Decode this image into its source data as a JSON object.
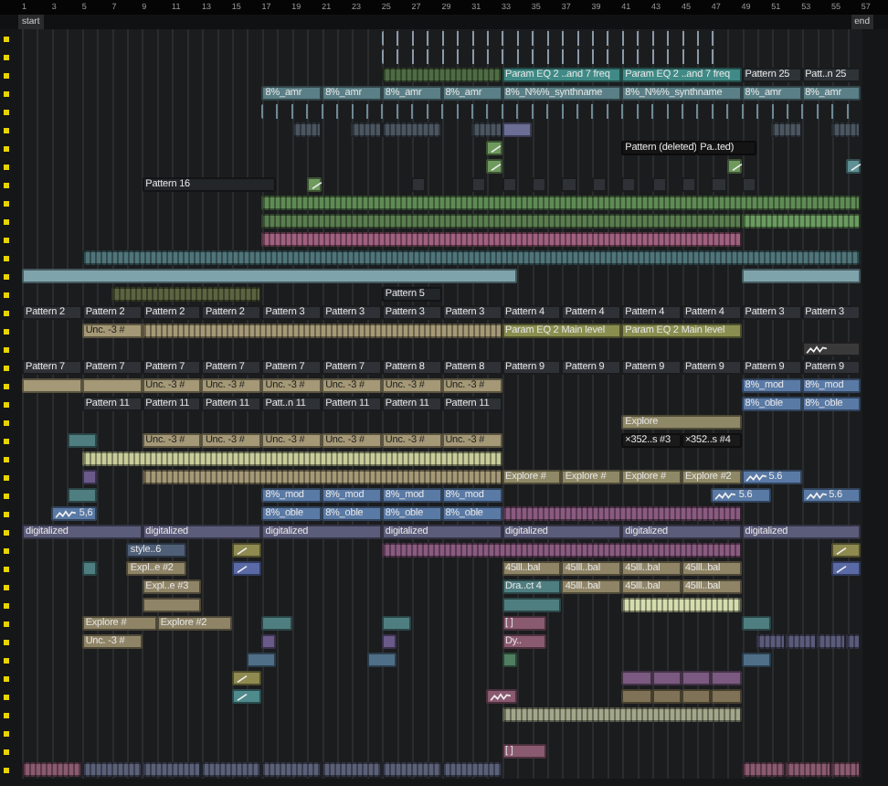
{
  "ruler": [
    "1",
    "3",
    "5",
    "7",
    "9",
    "11",
    "13",
    "15",
    "17",
    "19",
    "21",
    "23",
    "25",
    "27",
    "29",
    "31",
    "33",
    "35",
    "37",
    "39",
    "41",
    "43",
    "45",
    "47",
    "49",
    "51",
    "53",
    "55",
    "57"
  ],
  "markers": {
    "start": "start",
    "end": "end"
  },
  "tracks": [
    {
      "clips": [
        {
          "kind": "ticks",
          "color": "#8a9aa8"
        }
      ]
    },
    {
      "clips": [
        {
          "kind": "ticks",
          "color": "#8a9aa8"
        }
      ]
    },
    {
      "clips": [
        {
          "kind": "stripes",
          "color": "#4f6b45"
        },
        {
          "kind": "clip",
          "color": "#3f8a86",
          "label": "Param EQ 2 ..and 7 freq"
        },
        {
          "kind": "clip",
          "color": "#3f8a86",
          "label": "Param EQ 2 ..and 7 freq"
        },
        {
          "kind": "clip",
          "color": "#2e3338",
          "label": "Pattern 25"
        },
        {
          "kind": "clip",
          "color": "#2e3338",
          "label": "Patt..n 25"
        }
      ]
    },
    {
      "clips": [
        {
          "kind": "clip",
          "color": "#5a7f86",
          "label": "8%_amr"
        },
        {
          "kind": "clip",
          "color": "#5a7f86",
          "label": "8%_amr"
        },
        {
          "kind": "clip",
          "color": "#5a7f86",
          "label": "8%_amr"
        },
        {
          "kind": "clip",
          "color": "#5a7f86",
          "label": "8%_amr"
        },
        {
          "kind": "clip",
          "color": "#5a7f86",
          "label": "8%_N%%_synthname"
        },
        {
          "kind": "clip",
          "color": "#5a7f86",
          "label": "8%_N%%_synthname"
        },
        {
          "kind": "clip",
          "color": "#5a7f86",
          "label": "8%_amr"
        },
        {
          "kind": "clip",
          "color": "#5a7f86",
          "label": "8%_amr"
        }
      ]
    },
    {
      "clips": [
        {
          "kind": "ticks",
          "color": "#6d8894"
        }
      ]
    },
    {
      "clips": [
        {
          "kind": "stripes",
          "color": "#4a5560"
        },
        {
          "kind": "stripes",
          "color": "#4a5560"
        },
        {
          "kind": "stripes",
          "color": "#4a5560"
        },
        {
          "kind": "stripes",
          "color": "#4a5560"
        },
        {
          "kind": "clip",
          "color": "#6c6e96"
        },
        {
          "kind": "stripes",
          "color": "#4a5560"
        },
        {
          "kind": "stripes",
          "color": "#4a5560"
        }
      ]
    },
    {
      "clips": [
        {
          "kind": "curve",
          "color": "#6f9a5e"
        },
        {
          "kind": "clip",
          "color": "#141414",
          "label": "Pattern (deleted)"
        },
        {
          "kind": "clip",
          "color": "#141414",
          "label": "Pa..ted)"
        }
      ]
    },
    {
      "clips": [
        {
          "kind": "curve",
          "color": "#6f9a5e"
        },
        {
          "kind": "curve",
          "color": "#6f9a5e"
        },
        {
          "kind": "curve",
          "color": "#5f9096"
        }
      ]
    },
    {
      "clips": [
        {
          "kind": "clip",
          "color": "#232629",
          "label": "Pattern 16"
        },
        {
          "kind": "curve",
          "color": "#6f9a5e"
        },
        {
          "kind": "clip",
          "color": "#2e3236"
        },
        {
          "kind": "clip",
          "color": "#2e3236"
        },
        {
          "kind": "clip",
          "color": "#2e3236"
        },
        {
          "kind": "clip",
          "color": "#2e3236"
        },
        {
          "kind": "clip",
          "color": "#2e3236"
        },
        {
          "kind": "clip",
          "color": "#2e3236"
        },
        {
          "kind": "clip",
          "color": "#2e3236"
        },
        {
          "kind": "clip",
          "color": "#2e3236"
        },
        {
          "kind": "clip",
          "color": "#2e3236"
        },
        {
          "kind": "clip",
          "color": "#2e3236"
        },
        {
          "kind": "clip",
          "color": "#2e3236"
        }
      ]
    },
    {
      "clips": [
        {
          "kind": "stripes",
          "color": "#5f8a55"
        }
      ]
    },
    {
      "clips": [
        {
          "kind": "stripes",
          "color": "#5a7d50"
        },
        {
          "kind": "stripes",
          "color": "#6a9a60"
        }
      ]
    },
    {
      "clips": [
        {
          "kind": "stripes",
          "color": "#a0607f"
        }
      ]
    },
    {
      "clips": [
        {
          "kind": "stripes",
          "color": "#4f7479"
        }
      ]
    },
    {
      "clips": [
        {
          "kind": "clip",
          "color": "#7fa3ab"
        },
        {
          "kind": "clip",
          "color": "#7fa3ab"
        }
      ]
    },
    {
      "clips": [
        {
          "kind": "stripes",
          "color": "#5b6340"
        },
        {
          "kind": "clip",
          "color": "#232629",
          "label": "Pattern 5"
        }
      ]
    },
    {
      "clips": [
        {
          "kind": "clip",
          "color": "#2e3236",
          "label": "Pattern 2"
        },
        {
          "kind": "clip",
          "color": "#2e3236",
          "label": "Pattern 2"
        },
        {
          "kind": "clip",
          "color": "#2e3236",
          "label": "Pattern 2"
        },
        {
          "kind": "clip",
          "color": "#2e3236",
          "label": "Pattern 2"
        },
        {
          "kind": "clip",
          "color": "#2e3236",
          "label": "Pattern 3"
        },
        {
          "kind": "clip",
          "color": "#2e3236",
          "label": "Pattern 3"
        },
        {
          "kind": "clip",
          "color": "#2e3236",
          "label": "Pattern 3"
        },
        {
          "kind": "clip",
          "color": "#2e3236",
          "label": "Pattern 3"
        },
        {
          "kind": "clip",
          "color": "#2e3236",
          "label": "Pattern 4"
        },
        {
          "kind": "clip",
          "color": "#2e3236",
          "label": "Pattern 4"
        },
        {
          "kind": "clip",
          "color": "#2e3236",
          "label": "Pattern 4"
        },
        {
          "kind": "clip",
          "color": "#2e3236",
          "label": "Pattern 4"
        },
        {
          "kind": "clip",
          "color": "#2e3236",
          "label": "Pattern 3"
        },
        {
          "kind": "clip",
          "color": "#2e3236",
          "label": "Pattern 3"
        }
      ]
    },
    {
      "clips": [
        {
          "kind": "clip",
          "color": "#a49876",
          "label": "Unc. -3 #"
        },
        {
          "kind": "stripes",
          "color": "#a49876"
        },
        {
          "kind": "clip",
          "color": "#8a8f50",
          "label": "Param EQ 2 Main level"
        },
        {
          "kind": "clip",
          "color": "#8a8f50",
          "label": "Param EQ 2 Main level"
        }
      ]
    },
    {
      "clips": [
        {
          "kind": "squiggle",
          "color": "#3a3a3a"
        }
      ]
    },
    {
      "clips": [
        {
          "kind": "clip",
          "color": "#2e3236",
          "label": "Pattern 7"
        },
        {
          "kind": "clip",
          "color": "#2e3236",
          "label": "Pattern 7"
        },
        {
          "kind": "clip",
          "color": "#2e3236",
          "label": "Pattern 7"
        },
        {
          "kind": "clip",
          "color": "#2e3236",
          "label": "Pattern 7"
        },
        {
          "kind": "clip",
          "color": "#2e3236",
          "label": "Pattern 7"
        },
        {
          "kind": "clip",
          "color": "#2e3236",
          "label": "Pattern 7"
        },
        {
          "kind": "clip",
          "color": "#2e3236",
          "label": "Pattern 8"
        },
        {
          "kind": "clip",
          "color": "#2e3236",
          "label": "Pattern 8"
        },
        {
          "kind": "clip",
          "color": "#2e3236",
          "label": "Pattern 9"
        },
        {
          "kind": "clip",
          "color": "#2e3236",
          "label": "Pattern 9"
        },
        {
          "kind": "clip",
          "color": "#2e3236",
          "label": "Pattern 9"
        },
        {
          "kind": "clip",
          "color": "#2e3236",
          "label": "Pattern 9"
        },
        {
          "kind": "clip",
          "color": "#2e3236",
          "label": "Pattern 9"
        },
        {
          "kind": "clip",
          "color": "#2e3236",
          "label": "Pattern 9"
        }
      ]
    },
    {
      "clips": [
        {
          "kind": "clip",
          "color": "#a49876"
        },
        {
          "kind": "clip",
          "color": "#a49876"
        },
        {
          "kind": "clip",
          "color": "#a49876",
          "label": "Unc. -3 #"
        },
        {
          "kind": "clip",
          "color": "#a49876",
          "label": "Unc. -3 #"
        },
        {
          "kind": "clip",
          "color": "#a49876",
          "label": "Unc. -3 #"
        },
        {
          "kind": "clip",
          "color": "#a49876",
          "label": "Unc. -3 #"
        },
        {
          "kind": "clip",
          "color": "#a49876",
          "label": "Unc. -3 #"
        },
        {
          "kind": "clip",
          "color": "#a49876",
          "label": "Unc. -3 #"
        },
        {
          "kind": "clip",
          "color": "#5a7aa6",
          "label": "8%_mod"
        },
        {
          "kind": "clip",
          "color": "#5a7aa6",
          "label": "8%_mod"
        }
      ]
    },
    {
      "clips": [
        {
          "kind": "clip",
          "color": "#2e3236",
          "label": "Pattern 11"
        },
        {
          "kind": "clip",
          "color": "#2e3236",
          "label": "Pattern 11"
        },
        {
          "kind": "clip",
          "color": "#2e3236",
          "label": "Pattern 11"
        },
        {
          "kind": "clip",
          "color": "#2e3236",
          "label": "Patt..n 11"
        },
        {
          "kind": "clip",
          "color": "#2e3236",
          "label": "Pattern 11"
        },
        {
          "kind": "clip",
          "color": "#2e3236",
          "label": "Pattern 11"
        },
        {
          "kind": "clip",
          "color": "#2e3236",
          "label": "Pattern 11"
        },
        {
          "kind": "clip",
          "color": "#5a7aa6",
          "label": "8%_oble"
        },
        {
          "kind": "clip",
          "color": "#5a7aa6",
          "label": "8%_oble"
        }
      ]
    },
    {
      "clips": [
        {
          "kind": "clip",
          "color": "#8f8866",
          "label": "Explore"
        }
      ]
    },
    {
      "clips": [
        {
          "kind": "clip",
          "color": "#4f7e80"
        },
        {
          "kind": "clip",
          "color": "#a49876",
          "label": "Unc. -3 #"
        },
        {
          "kind": "clip",
          "color": "#a49876",
          "label": "Unc. -3 #"
        },
        {
          "kind": "clip",
          "color": "#a49876",
          "label": "Unc. -3 #"
        },
        {
          "kind": "clip",
          "color": "#a49876",
          "label": "Unc. -3 #"
        },
        {
          "kind": "clip",
          "color": "#a49876",
          "label": "Unc. -3 #"
        },
        {
          "kind": "clip",
          "color": "#a49876",
          "label": "Unc. -3 #"
        },
        {
          "kind": "clip",
          "color": "#1a1a1a",
          "label": "×352..s #3"
        },
        {
          "kind": "clip",
          "color": "#1a1a1a",
          "label": "×352..s #4"
        }
      ]
    },
    {
      "clips": [
        {
          "kind": "stripes",
          "color": "#c7cc9a"
        }
      ]
    },
    {
      "clips": [
        {
          "kind": "clip",
          "color": "#6a5a8a"
        },
        {
          "kind": "stripes",
          "color": "#a49876"
        },
        {
          "kind": "clip",
          "color": "#8f8866",
          "label": "Explore #"
        },
        {
          "kind": "clip",
          "color": "#8f8866",
          "label": "Explore #"
        },
        {
          "kind": "clip",
          "color": "#8f8866",
          "label": "Explore #"
        },
        {
          "kind": "clip",
          "color": "#8f8866",
          "label": "Explore #2"
        },
        {
          "kind": "squiggle",
          "color": "#5a7aa6",
          "label": "5.6"
        }
      ]
    },
    {
      "clips": [
        {
          "kind": "clip",
          "color": "#4f7e80"
        },
        {
          "kind": "clip",
          "color": "#5a7aa6",
          "label": "8%_mod"
        },
        {
          "kind": "clip",
          "color": "#5a7aa6",
          "label": "8%_mod"
        },
        {
          "kind": "clip",
          "color": "#5a7aa6",
          "label": "8%_mod"
        },
        {
          "kind": "clip",
          "color": "#5a7aa6",
          "label": "8%_mod"
        },
        {
          "kind": "squiggle",
          "color": "#5a7aa6",
          "label": "5.6"
        },
        {
          "kind": "squiggle",
          "color": "#5a7aa6",
          "label": "5.6"
        }
      ]
    },
    {
      "clips": [
        {
          "kind": "squiggle",
          "color": "#5a7aa6",
          "label": "5,6"
        },
        {
          "kind": "clip",
          "color": "#5a7aa6",
          "label": "8%_oble"
        },
        {
          "kind": "clip",
          "color": "#5a7aa6",
          "label": "8%_oble"
        },
        {
          "kind": "clip",
          "color": "#5a7aa6",
          "label": "8%_oble"
        },
        {
          "kind": "clip",
          "color": "#5a7aa6",
          "label": "8%_oble"
        },
        {
          "kind": "stripes",
          "color": "#8a5a80"
        }
      ]
    },
    {
      "clips": [
        {
          "kind": "clip",
          "color": "#5b5b7a",
          "label": "digitalized"
        },
        {
          "kind": "clip",
          "color": "#5b5b7a",
          "label": "digitalized"
        },
        {
          "kind": "clip",
          "color": "#5b5b7a",
          "label": "digitalized"
        },
        {
          "kind": "clip",
          "color": "#5b5b7a",
          "label": "digitalized"
        },
        {
          "kind": "clip",
          "color": "#5b5b7a",
          "label": "digitalized"
        },
        {
          "kind": "clip",
          "color": "#5b5b7a",
          "label": "digitalized"
        },
        {
          "kind": "clip",
          "color": "#5b5b7a",
          "label": "digitalized"
        }
      ]
    },
    {
      "clips": [
        {
          "kind": "clip",
          "color": "#4f5f78",
          "label": "style..6"
        },
        {
          "kind": "curve",
          "color": "#8f8a50"
        },
        {
          "kind": "stripes",
          "color": "#8a5a80"
        },
        {
          "kind": "curve",
          "color": "#8f8a50"
        }
      ]
    },
    {
      "clips": [
        {
          "kind": "clip",
          "color": "#4f7e80"
        },
        {
          "kind": "clip",
          "color": "#8f8466",
          "label": "Expl..e #2"
        },
        {
          "kind": "curve",
          "color": "#5a6aa6"
        },
        {
          "kind": "clip",
          "color": "#8f8466",
          "label": "45lll..bal"
        },
        {
          "kind": "clip",
          "color": "#8f8466",
          "label": "45lll..bal"
        },
        {
          "kind": "clip",
          "color": "#8f8466",
          "label": "45lll..bal"
        },
        {
          "kind": "clip",
          "color": "#8f8466",
          "label": "45lll..bal"
        },
        {
          "kind": "curve",
          "color": "#5a6aa6"
        }
      ]
    },
    {
      "clips": [
        {
          "kind": "clip",
          "color": "#8f8466",
          "label": "Expl..e #3"
        },
        {
          "kind": "clip",
          "color": "#4f7e80",
          "label": "Dra..ct 4"
        },
        {
          "kind": "clip",
          "color": "#8f8466",
          "label": "45lll..bal"
        },
        {
          "kind": "clip",
          "color": "#8f8466",
          "label": "45lll..bal"
        },
        {
          "kind": "clip",
          "color": "#8f8466",
          "label": "45lll..bal"
        }
      ]
    },
    {
      "clips": [
        {
          "kind": "clip",
          "color": "#8f8466"
        },
        {
          "kind": "clip",
          "color": "#4f7e80"
        },
        {
          "kind": "stripes",
          "color": "#d5dcae"
        }
      ]
    },
    {
      "clips": [
        {
          "kind": "clip",
          "color": "#8f8466",
          "label": "Explore #"
        },
        {
          "kind": "clip",
          "color": "#8f8466",
          "label": "Explore #2"
        },
        {
          "kind": "clip",
          "color": "#4f7e80"
        },
        {
          "kind": "clip",
          "color": "#4f7e80"
        },
        {
          "kind": "clip",
          "color": "#8a5a70",
          "label": "[ ]"
        },
        {
          "kind": "clip",
          "color": "#4f7e80"
        }
      ]
    },
    {
      "clips": [
        {
          "kind": "clip",
          "color": "#8f8466",
          "label": "Unc. -3 #"
        },
        {
          "kind": "clip",
          "color": "#6a5a8a"
        },
        {
          "kind": "clip",
          "color": "#6a5a8a"
        },
        {
          "kind": "clip",
          "color": "#8a5a70",
          "label": "Dy.."
        },
        {
          "kind": "stripes",
          "color": "#5a5a7a"
        },
        {
          "kind": "stripes",
          "color": "#5a5a7a"
        },
        {
          "kind": "stripes",
          "color": "#5a5a7a"
        },
        {
          "kind": "stripes",
          "color": "#5a5a7a"
        }
      ]
    },
    {
      "clips": [
        {
          "kind": "clip",
          "color": "#4f6f88"
        },
        {
          "kind": "clip",
          "color": "#4f6f88"
        },
        {
          "kind": "clip",
          "color": "#4f7e60"
        },
        {
          "kind": "clip",
          "color": "#4f6f88"
        }
      ]
    },
    {
      "clips": [
        {
          "kind": "curve",
          "color": "#8f8a50"
        },
        {
          "kind": "clip",
          "color": "#7a5a80"
        },
        {
          "kind": "clip",
          "color": "#7a5a80"
        },
        {
          "kind": "clip",
          "color": "#7a5a80"
        },
        {
          "kind": "clip",
          "color": "#7a5a80"
        }
      ]
    },
    {
      "clips": [
        {
          "kind": "curve",
          "color": "#4f8a8c"
        },
        {
          "kind": "squiggle",
          "color": "#8a5a70"
        },
        {
          "kind": "clip",
          "color": "#7f7256"
        },
        {
          "kind": "clip",
          "color": "#7f7256"
        },
        {
          "kind": "clip",
          "color": "#7f7256"
        },
        {
          "kind": "clip",
          "color": "#7f7256"
        }
      ]
    },
    {
      "clips": [
        {
          "kind": "stripes",
          "color": "#a3a78a"
        }
      ]
    },
    {
      "clips": [
        {
          "kind": "clip",
          "color": "#8a5a70",
          "label": "[ ]"
        }
      ]
    },
    {
      "clips": [
        {
          "kind": "stripes",
          "color": "#8a5a70"
        },
        {
          "kind": "stripes",
          "color": "#5a6078"
        },
        {
          "kind": "stripes",
          "color": "#5a6078"
        },
        {
          "kind": "stripes",
          "color": "#5a6078"
        },
        {
          "kind": "stripes",
          "color": "#5a6078"
        },
        {
          "kind": "stripes",
          "color": "#5a6078"
        },
        {
          "kind": "stripes",
          "color": "#5a6078"
        },
        {
          "kind": "stripes",
          "color": "#5a6078"
        },
        {
          "kind": "stripes",
          "color": "#8a5a70"
        },
        {
          "kind": "stripes",
          "color": "#8a5a70"
        },
        {
          "kind": "stripes",
          "color": "#8a5a70"
        }
      ]
    }
  ]
}
